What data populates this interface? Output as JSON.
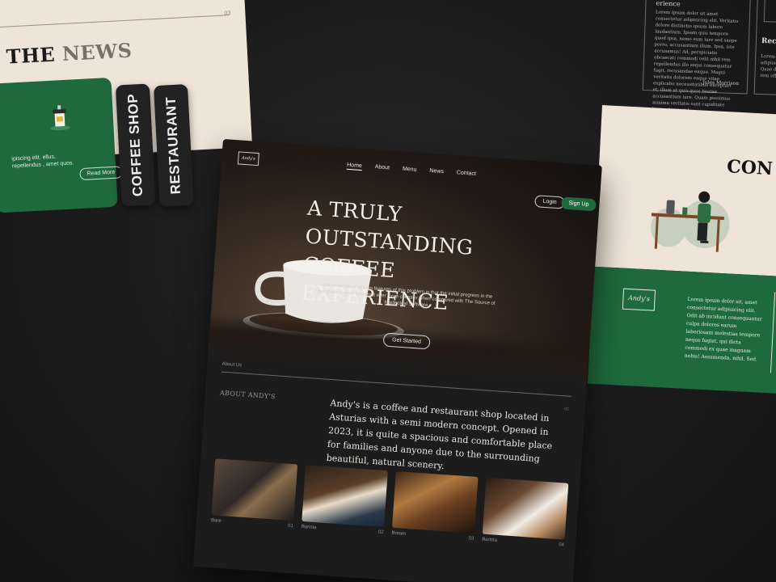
{
  "news": {
    "title_a": "THE",
    "title_b": "NEWS",
    "num": "03",
    "body": "ipiscing elit. ellus, repellendus , amet quos.",
    "read_more": "Read More",
    "tabs": [
      "COFFEE SHOP",
      "RESTAURANT"
    ]
  },
  "articles": {
    "partial_title": "erience",
    "body": "Lorem ipsum dolor sit amet consectetur adipisicing elit. Veritatis dolore distinctio ipsum labore laudantium. Ipsam quis tempore quod ipsa, nemo eum iure sed saepe porro, accusantium illum. Ipsa, iste accusamus! Ad, perspiciatis obcaecati commodi velit nihil rem repellendus illo sequi consequatur fugit, recusandae eaque. Magni veritatis dolorem eaque vitae explicabo necessitatibus excepturi et, illum ut quis quos beatae accusantium iure. Quam possimus minima veritatis sunt cupiditate harum tempora!",
    "author": "Jules Morrison",
    "second_title": "Rec",
    "second_body": "Lorem ipsum adipisicing elit. Quae deleniti rem officiis."
  },
  "contact": {
    "title": "CON",
    "logo": "Andy's",
    "body": "Lorem ipsum dolor sit, amet consectetur adipisicing elit. Odit ab incidunt consequuntur culpa dolores earum laboriosam molestias tempore neque fugiat, qui dicta commodi ex quae magnam nobis! Assumenda, nihil. Sed."
  },
  "main": {
    "logo": "Andy's",
    "nav": [
      "Home",
      "About",
      "Menu",
      "News",
      "Contact"
    ],
    "login": "Login",
    "signup": "Sign Up",
    "hero_title_1": "A TRULY",
    "hero_title_2": "OUTSTANDING",
    "hero_title_3": "COFFEE EXPERIENCE",
    "hero_sub": "One of the most striking features of this problem is that the initial progress in the feedback system becomes ever more complex when compared with The Source of Intellectual Software",
    "cta": "Get Started",
    "about_tab": "About Us",
    "about_heading": "ABOUT ANDY'S",
    "about_num": "02",
    "about_text": "Andy's is a coffee and restaurant shop located in Asturias with a semi modern concept. Opened in 2023, it is quite a spacious and comfortable place for families and anyone due to the surrounding beautiful, natural scenery.",
    "gallery": [
      {
        "caption": "Bare",
        "num": "01"
      },
      {
        "caption": "Barista",
        "num": "02"
      },
      {
        "caption": "Bream",
        "num": "03"
      },
      {
        "caption": "Barista",
        "num": "04"
      }
    ]
  },
  "colors": {
    "green": "#1f6a3c",
    "cream": "#efe4d8",
    "dark": "#1c1c1c"
  }
}
